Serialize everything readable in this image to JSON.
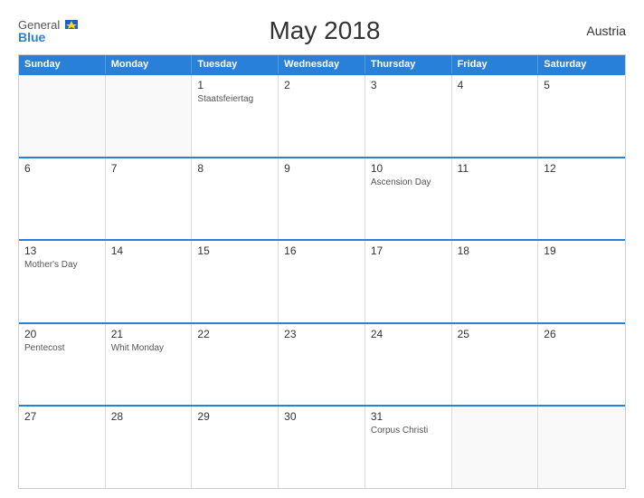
{
  "header": {
    "logo_general": "General",
    "logo_blue": "Blue",
    "title": "May 2018",
    "country": "Austria"
  },
  "days_of_week": [
    "Sunday",
    "Monday",
    "Tuesday",
    "Wednesday",
    "Thursday",
    "Friday",
    "Saturday"
  ],
  "weeks": [
    [
      {
        "day": "",
        "holiday": "",
        "empty": true
      },
      {
        "day": "",
        "holiday": "",
        "empty": true
      },
      {
        "day": "1",
        "holiday": "Staatsfeiertag",
        "empty": false
      },
      {
        "day": "2",
        "holiday": "",
        "empty": false
      },
      {
        "day": "3",
        "holiday": "",
        "empty": false
      },
      {
        "day": "4",
        "holiday": "",
        "empty": false
      },
      {
        "day": "5",
        "holiday": "",
        "empty": false
      }
    ],
    [
      {
        "day": "6",
        "holiday": "",
        "empty": false
      },
      {
        "day": "7",
        "holiday": "",
        "empty": false
      },
      {
        "day": "8",
        "holiday": "",
        "empty": false
      },
      {
        "day": "9",
        "holiday": "",
        "empty": false
      },
      {
        "day": "10",
        "holiday": "Ascension Day",
        "empty": false
      },
      {
        "day": "11",
        "holiday": "",
        "empty": false
      },
      {
        "day": "12",
        "holiday": "",
        "empty": false
      }
    ],
    [
      {
        "day": "13",
        "holiday": "Mother's Day",
        "empty": false
      },
      {
        "day": "14",
        "holiday": "",
        "empty": false
      },
      {
        "day": "15",
        "holiday": "",
        "empty": false
      },
      {
        "day": "16",
        "holiday": "",
        "empty": false
      },
      {
        "day": "17",
        "holiday": "",
        "empty": false
      },
      {
        "day": "18",
        "holiday": "",
        "empty": false
      },
      {
        "day": "19",
        "holiday": "",
        "empty": false
      }
    ],
    [
      {
        "day": "20",
        "holiday": "Pentecost",
        "empty": false
      },
      {
        "day": "21",
        "holiday": "Whit Monday",
        "empty": false
      },
      {
        "day": "22",
        "holiday": "",
        "empty": false
      },
      {
        "day": "23",
        "holiday": "",
        "empty": false
      },
      {
        "day": "24",
        "holiday": "",
        "empty": false
      },
      {
        "day": "25",
        "holiday": "",
        "empty": false
      },
      {
        "day": "26",
        "holiday": "",
        "empty": false
      }
    ],
    [
      {
        "day": "27",
        "holiday": "",
        "empty": false
      },
      {
        "day": "28",
        "holiday": "",
        "empty": false
      },
      {
        "day": "29",
        "holiday": "",
        "empty": false
      },
      {
        "day": "30",
        "holiday": "",
        "empty": false
      },
      {
        "day": "31",
        "holiday": "Corpus Christi",
        "empty": false
      },
      {
        "day": "",
        "holiday": "",
        "empty": true
      },
      {
        "day": "",
        "holiday": "",
        "empty": true
      }
    ]
  ]
}
